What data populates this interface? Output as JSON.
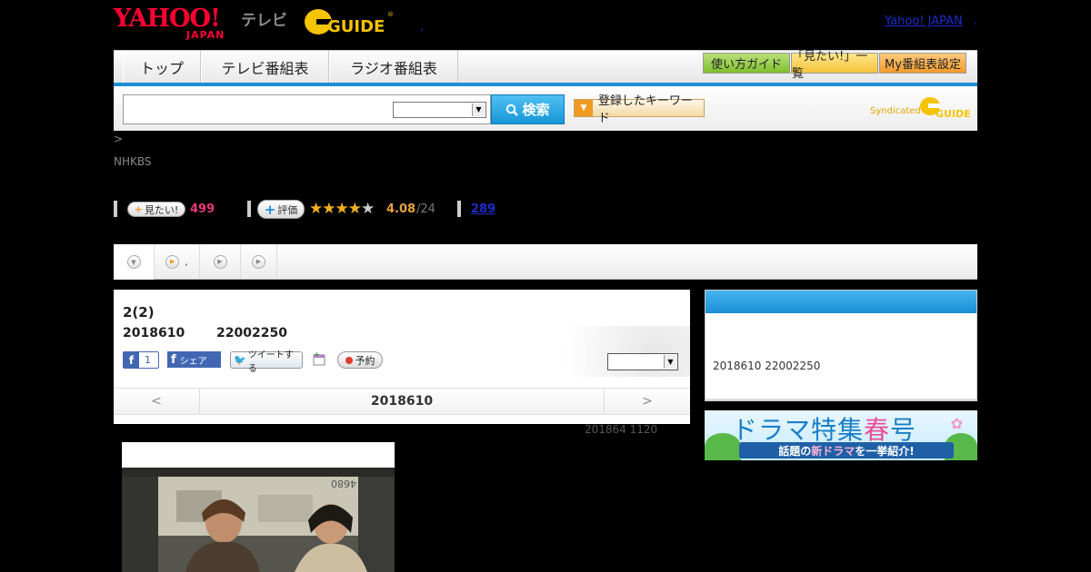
{
  "header": {
    "yahoo_logo": "YAHOO!",
    "yahoo_sub": "JAPAN",
    "tv_label": "テレビ",
    "gguide_logo": "GUIDE",
    "hdr_dot": ",",
    "yahoo_japan_link": "Yahoo! JAPAN",
    "link_dot": "."
  },
  "nav": {
    "tabs": [
      {
        "label": "トップ"
      },
      {
        "label": "テレビ番組表"
      },
      {
        "label": "ラジオ番組表"
      }
    ],
    "guide_btn": "使い方ガイド",
    "wish_btn": "「見たい!」一覧",
    "my_btn": "My番組表設定"
  },
  "search": {
    "input_value": "",
    "select_value": "",
    "button_label": "検索",
    "keyword_button": "登録したキーワード",
    "syndicated": "Syndicated",
    "syndicated_logo": "GUIDE"
  },
  "program": {
    "breadcrumb": ">",
    "channel": "NHKBS",
    "mitai_label": "見たい!",
    "mitai_count": "499",
    "hyoka_label": "評価",
    "rating_value": 4.08,
    "rating_text": "4.08",
    "rating_count": "/24",
    "review_count": "289",
    "title": "2(2)",
    "date": "2018610",
    "time": "22002250",
    "fb_like_count": "1",
    "fb_share": "シェア",
    "tweet": "ツイートする",
    "yoyaku": "予約",
    "pager_prev": "<",
    "pager_date": "2018610",
    "pager_next": ">",
    "update_note": "201864  1120"
  },
  "tabs": {
    "tab2_suffix": ","
  },
  "side": {
    "info_text": "2018610  22002250",
    "banner_title_a": "ドラマ特集",
    "banner_title_b": "春",
    "banner_title_c": "号",
    "banner_sub_a": "話題の",
    "banner_sub_b": "新ドラマ",
    "banner_sub_c": "を一挙紹介!"
  },
  "colors": {
    "yahoo_red": "#ff0033",
    "link_blue": "#1a2ccc",
    "nav_blue": "#1c8fd6",
    "star_gold": "#f2b01e",
    "count_pink": "#e63a7b"
  }
}
